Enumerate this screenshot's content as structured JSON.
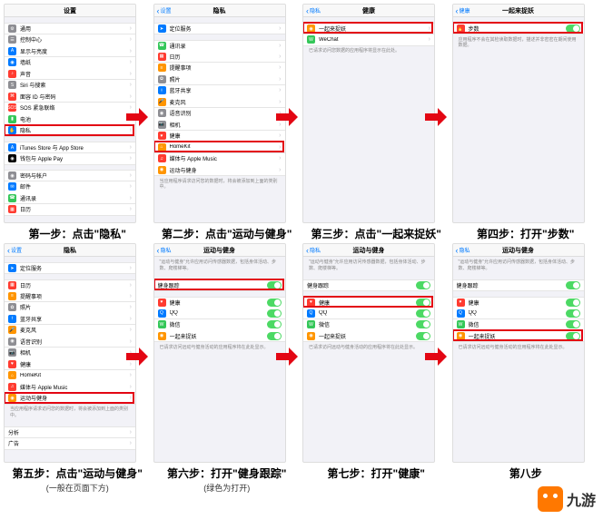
{
  "steps": [
    {
      "caption": "第一步：点击\"隐私\"",
      "nav": {
        "title": "设置",
        "back": ""
      },
      "highlight_index": 9,
      "sections": [
        [
          {
            "icon": "#8e8e93",
            "iconChar": "⚙",
            "label": "通用"
          },
          {
            "icon": "#8e8e93",
            "iconChar": "☰",
            "label": "控制中心"
          },
          {
            "icon": "#007aff",
            "iconChar": "A",
            "label": "显示与亮度"
          },
          {
            "icon": "#007aff",
            "iconChar": "◉",
            "label": "墙纸"
          },
          {
            "icon": "#ff3b30",
            "iconChar": "♪",
            "label": "声音"
          },
          {
            "icon": "#8e8e93",
            "iconChar": "S",
            "label": "Siri 与搜索"
          },
          {
            "icon": "#ff3b30",
            "iconChar": "⌘",
            "label": "面容 ID 与密码"
          },
          {
            "icon": "#ff3b30",
            "iconChar": "SOS",
            "label": "SOS 紧急联络"
          },
          {
            "icon": "#34c759",
            "iconChar": "▮",
            "label": "电池"
          },
          {
            "icon": "#007aff",
            "iconChar": "✋",
            "label": "隐私"
          }
        ],
        [
          {
            "icon": "#007aff",
            "iconChar": "A",
            "label": "iTunes Store 与 App Store"
          },
          {
            "icon": "#000",
            "iconChar": "◉",
            "label": "钱包与 Apple Pay"
          }
        ],
        [
          {
            "icon": "#8e8e93",
            "iconChar": "◉",
            "label": "密码与帐户"
          },
          {
            "icon": "#007aff",
            "iconChar": "✉",
            "label": "邮件"
          },
          {
            "icon": "#34c759",
            "iconChar": "☎",
            "label": "通讯录"
          },
          {
            "icon": "#ff3b30",
            "iconChar": "▦",
            "label": "日历"
          }
        ]
      ]
    },
    {
      "caption": "第二步：点击\"运动与健身\"",
      "nav": {
        "title": "隐私",
        "back": "设置"
      },
      "highlight_index": 10,
      "sections": [
        [
          {
            "icon": "#007aff",
            "iconChar": "➤",
            "label": "定位服务"
          }
        ],
        [
          {
            "icon": "#34c759",
            "iconChar": "☎",
            "label": "通讯录"
          },
          {
            "icon": "#ff3b30",
            "iconChar": "▦",
            "label": "日历"
          },
          {
            "icon": "#ff9500",
            "iconChar": "≡",
            "label": "提醒事项"
          },
          {
            "icon": "#8e8e93",
            "iconChar": "✿",
            "label": "照片"
          },
          {
            "icon": "#007aff",
            "iconChar": "ᚼ",
            "label": "蓝牙共享"
          },
          {
            "icon": "#ff9500",
            "iconChar": "🎤",
            "label": "麦克风"
          },
          {
            "icon": "#8e8e93",
            "iconChar": "◉",
            "label": "语音识别"
          },
          {
            "icon": "#8e8e93",
            "iconChar": "📷",
            "label": "相机"
          },
          {
            "icon": "#ff3b30",
            "iconChar": "♥",
            "label": "健康"
          },
          {
            "icon": "#ff9500",
            "iconChar": "⌂",
            "label": "HomeKit"
          },
          {
            "icon": "#ff3b30",
            "iconChar": "♫",
            "label": "媒体与 Apple Music"
          },
          {
            "icon": "#ff9500",
            "iconChar": "◉",
            "label": "运动与健身"
          }
        ]
      ],
      "desc": "当应用程序请求访问您的数据时，将会被添加到上面的类别中。"
    },
    {
      "caption": "第三步：点击\"一起来捉妖\"",
      "nav": {
        "title": "健康",
        "back": "隐私"
      },
      "highlight_index": 0,
      "sections": [
        [
          {
            "icon": "#ff9500",
            "iconChar": "◉",
            "label": "一起来捉妖"
          },
          {
            "icon": "#34c759",
            "iconChar": "W",
            "label": "WeChat"
          }
        ]
      ],
      "desc": "已请求访问您数据的应用程序将显示在此处。"
    },
    {
      "caption": "第四步：打开\"步数\"",
      "nav": {
        "title": "一起来捉妖",
        "back": "健康"
      },
      "highlight_index": 0,
      "toggleRows": true,
      "sections": [
        [
          {
            "icon": "#ff3b30",
            "iconChar": "🔥",
            "label": "步数",
            "toggle": true
          }
        ]
      ],
      "desc": "应用程序不会在其检读取数据时，描述并非密密在期间使用数据。"
    },
    {
      "caption": "第五步：点击\"运动与健身\"",
      "subcap": "(一般在页面下方)",
      "nav": {
        "title": "隐私",
        "back": "设置"
      },
      "highlight_index": 11,
      "sections": [
        [
          {
            "icon": "#007aff",
            "iconChar": "➤",
            "label": "定位服务"
          }
        ],
        [
          {
            "icon": "#ff3b30",
            "iconChar": "▦",
            "label": "日历"
          },
          {
            "icon": "#ff9500",
            "iconChar": "≡",
            "label": "提醒事项"
          },
          {
            "icon": "#8e8e93",
            "iconChar": "✿",
            "label": "照片"
          },
          {
            "icon": "#007aff",
            "iconChar": "ᚼ",
            "label": "蓝牙共享"
          },
          {
            "icon": "#ff9500",
            "iconChar": "🎤",
            "label": "麦克风"
          },
          {
            "icon": "#8e8e93",
            "iconChar": "◉",
            "label": "语音识别"
          },
          {
            "icon": "#8e8e93",
            "iconChar": "📷",
            "label": "相机"
          },
          {
            "icon": "#ff3b30",
            "iconChar": "♥",
            "label": "健康"
          },
          {
            "icon": "#ff9500",
            "iconChar": "⌂",
            "label": "HomeKit"
          },
          {
            "icon": "#ff3b30",
            "iconChar": "♫",
            "label": "媒体与 Apple Music"
          },
          {
            "icon": "#ff9500",
            "iconChar": "◉",
            "label": "运动与健身"
          }
        ]
      ],
      "desc": "当应用程序请求访问您的数据时，将会被添加到上面的类别中。",
      "extraSections": [
        [
          {
            "icon": "",
            "label": "分析"
          },
          {
            "icon": "",
            "label": "广告"
          }
        ]
      ]
    },
    {
      "caption": "第六步：打开\"健身跟踪\"",
      "subcap": "(绿色为打开)",
      "nav": {
        "title": "运动与健身",
        "back": "隐私"
      },
      "highlight_index": 0,
      "toggleRows": true,
      "sections": [
        [
          {
            "icon": "",
            "label": "健身跟踪",
            "toggle": true
          }
        ],
        [
          {
            "icon": "#ff3b30",
            "iconChar": "♥",
            "label": "健康",
            "toggle": true
          },
          {
            "icon": "#007aff",
            "iconChar": "Q",
            "label": "QQ",
            "toggle": true
          },
          {
            "icon": "#34c759",
            "iconChar": "W",
            "label": "微信",
            "toggle": true
          },
          {
            "icon": "#ff9500",
            "iconChar": "◉",
            "label": "一起来捉妖",
            "toggle": true
          }
        ]
      ],
      "topDesc": "\"运动与健身\"允许应用访问传感器数据，包括身体活动、步数、爬楼梯等。",
      "desc": "已请求访问远动与健身活动的应用程序将在此处显示。"
    },
    {
      "caption": "第七步：打开\"健康\"",
      "nav": {
        "title": "运动与健身",
        "back": "隐私"
      },
      "highlight_index": 1,
      "toggleRows": true,
      "sections": [
        [
          {
            "icon": "",
            "label": "健身跟踪",
            "toggle": true
          }
        ],
        [
          {
            "icon": "#ff3b30",
            "iconChar": "♥",
            "label": "健康",
            "toggle": true
          },
          {
            "icon": "#007aff",
            "iconChar": "Q",
            "label": "QQ",
            "toggle": true
          },
          {
            "icon": "#34c759",
            "iconChar": "W",
            "label": "微信",
            "toggle": true
          },
          {
            "icon": "#ff9500",
            "iconChar": "◉",
            "label": "一起来捉妖",
            "toggle": true
          }
        ]
      ],
      "topDesc": "\"运动与健身\"允许应用访问传感器数据，包括身体活动、步数、爬楼梯等。",
      "desc": "已请求访问远动与健身活动的应用程序将在此处显示。"
    },
    {
      "caption": "第八步",
      "nav": {
        "title": "运动与健身",
        "back": "隐私"
      },
      "highlight_index": 4,
      "toggleRows": true,
      "sections": [
        [
          {
            "icon": "",
            "label": "健身跟踪",
            "toggle": true
          }
        ],
        [
          {
            "icon": "#ff3b30",
            "iconChar": "♥",
            "label": "健康",
            "toggle": true
          },
          {
            "icon": "#007aff",
            "iconChar": "Q",
            "label": "QQ",
            "toggle": true
          },
          {
            "icon": "#34c759",
            "iconChar": "W",
            "label": "微信",
            "toggle": true
          },
          {
            "icon": "#ff9500",
            "iconChar": "◉",
            "label": "一起来捉妖",
            "toggle": true
          }
        ]
      ],
      "topDesc": "\"运动与健身\"允许应用访问传感器数据，包括身体活动、步数、爬楼梯等。",
      "desc": "已请求访问远动与健身活动的应用程序将在此处显示。"
    }
  ],
  "logo": "九游"
}
